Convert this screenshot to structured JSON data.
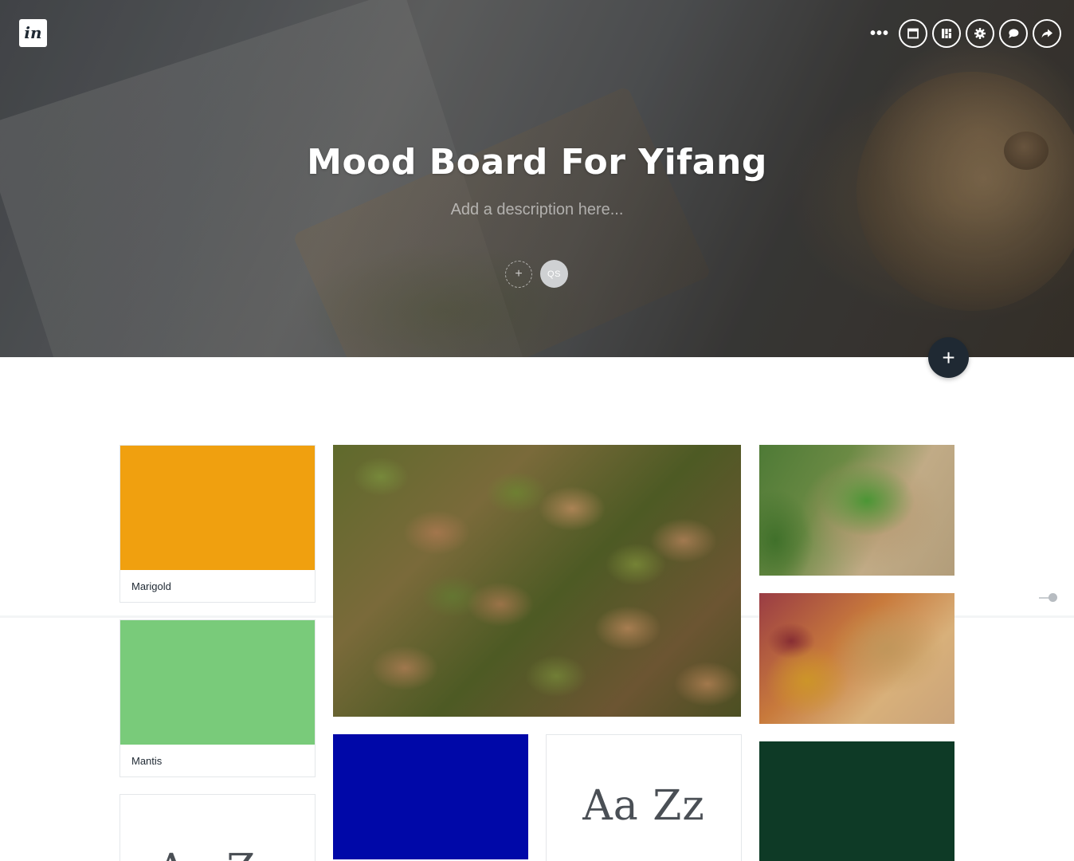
{
  "app": {
    "logo_text": "in"
  },
  "toolbar": {
    "more_label": "•••",
    "buttons": [
      {
        "name": "layout-icon"
      },
      {
        "name": "columns-icon"
      },
      {
        "name": "settings-icon"
      },
      {
        "name": "comment-icon"
      },
      {
        "name": "share-icon"
      }
    ]
  },
  "board": {
    "title": "Mood Board For Yifang",
    "description_placeholder": "Add a description here...",
    "add_collaborator_label": "+",
    "avatar_initials": "QS",
    "add_item_label": "+"
  },
  "cards": {
    "marigold": {
      "label": "Marigold",
      "color": "#F0A00F"
    },
    "mantis": {
      "label": "Mantis",
      "color": "#79CB7A"
    },
    "blue": {
      "color": "#0008A8"
    },
    "dark_green": {
      "color": "#0E3A26"
    },
    "type_sample": "Aa Zz",
    "type_sample_partial": "Aa Zz"
  },
  "colors": {
    "fab_background": "#1F2933",
    "avatar_background": "#CFD1D3"
  }
}
